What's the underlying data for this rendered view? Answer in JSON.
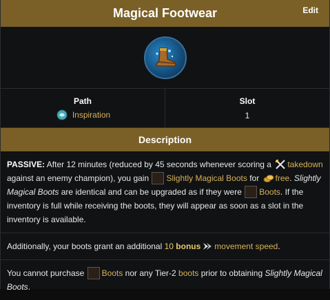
{
  "header": {
    "title": "Magical Footwear",
    "edit_label": "Edit"
  },
  "stats": {
    "path_label": "Path",
    "path_value": "Inspiration",
    "slot_label": "Slot",
    "slot_value": "1"
  },
  "description": {
    "section_title": "Description",
    "p1": {
      "passive": "PASSIVE:",
      "t1": " After 12 minutes (reduced by 45 seconds whenever scoring a ",
      "takedown": "takedown",
      "t2": " against an enemy champion), you gain ",
      "smb_link": "Slightly Magical Boots",
      "t3": " for ",
      "free": "free",
      "t4": ". ",
      "smb_italic": "Slightly Magical Boots",
      "t5": " are identical and can be upgraded as if they were ",
      "boots_link": "Boots",
      "t6": ". If the inventory is full while receiving the boots, they will appear as soon as a slot in the inventory is available."
    },
    "p2": {
      "t1": "Additionally, your boots grant an additional ",
      "num": "10",
      "bonus": "bonus",
      "ms_link": "movement speed",
      "t2": "."
    },
    "p3": {
      "t1": "You cannot purchase ",
      "boots_link": "Boots",
      "t2": " nor any Tier-2 ",
      "boots_lower": "boots",
      "t3": " prior to obtaining ",
      "smb_italic": "Slightly Magical Boots",
      "t4": "."
    }
  },
  "colors": {
    "bar": "#7a6027",
    "link_gold": "#d8b25a",
    "background": "#101214"
  },
  "icons": {
    "item": "magical-boots-icon",
    "path": "inspiration-icon",
    "takedown": "takedown-swords-icon",
    "gold": "gold-coins-icon",
    "movement": "movement-speed-icon"
  }
}
